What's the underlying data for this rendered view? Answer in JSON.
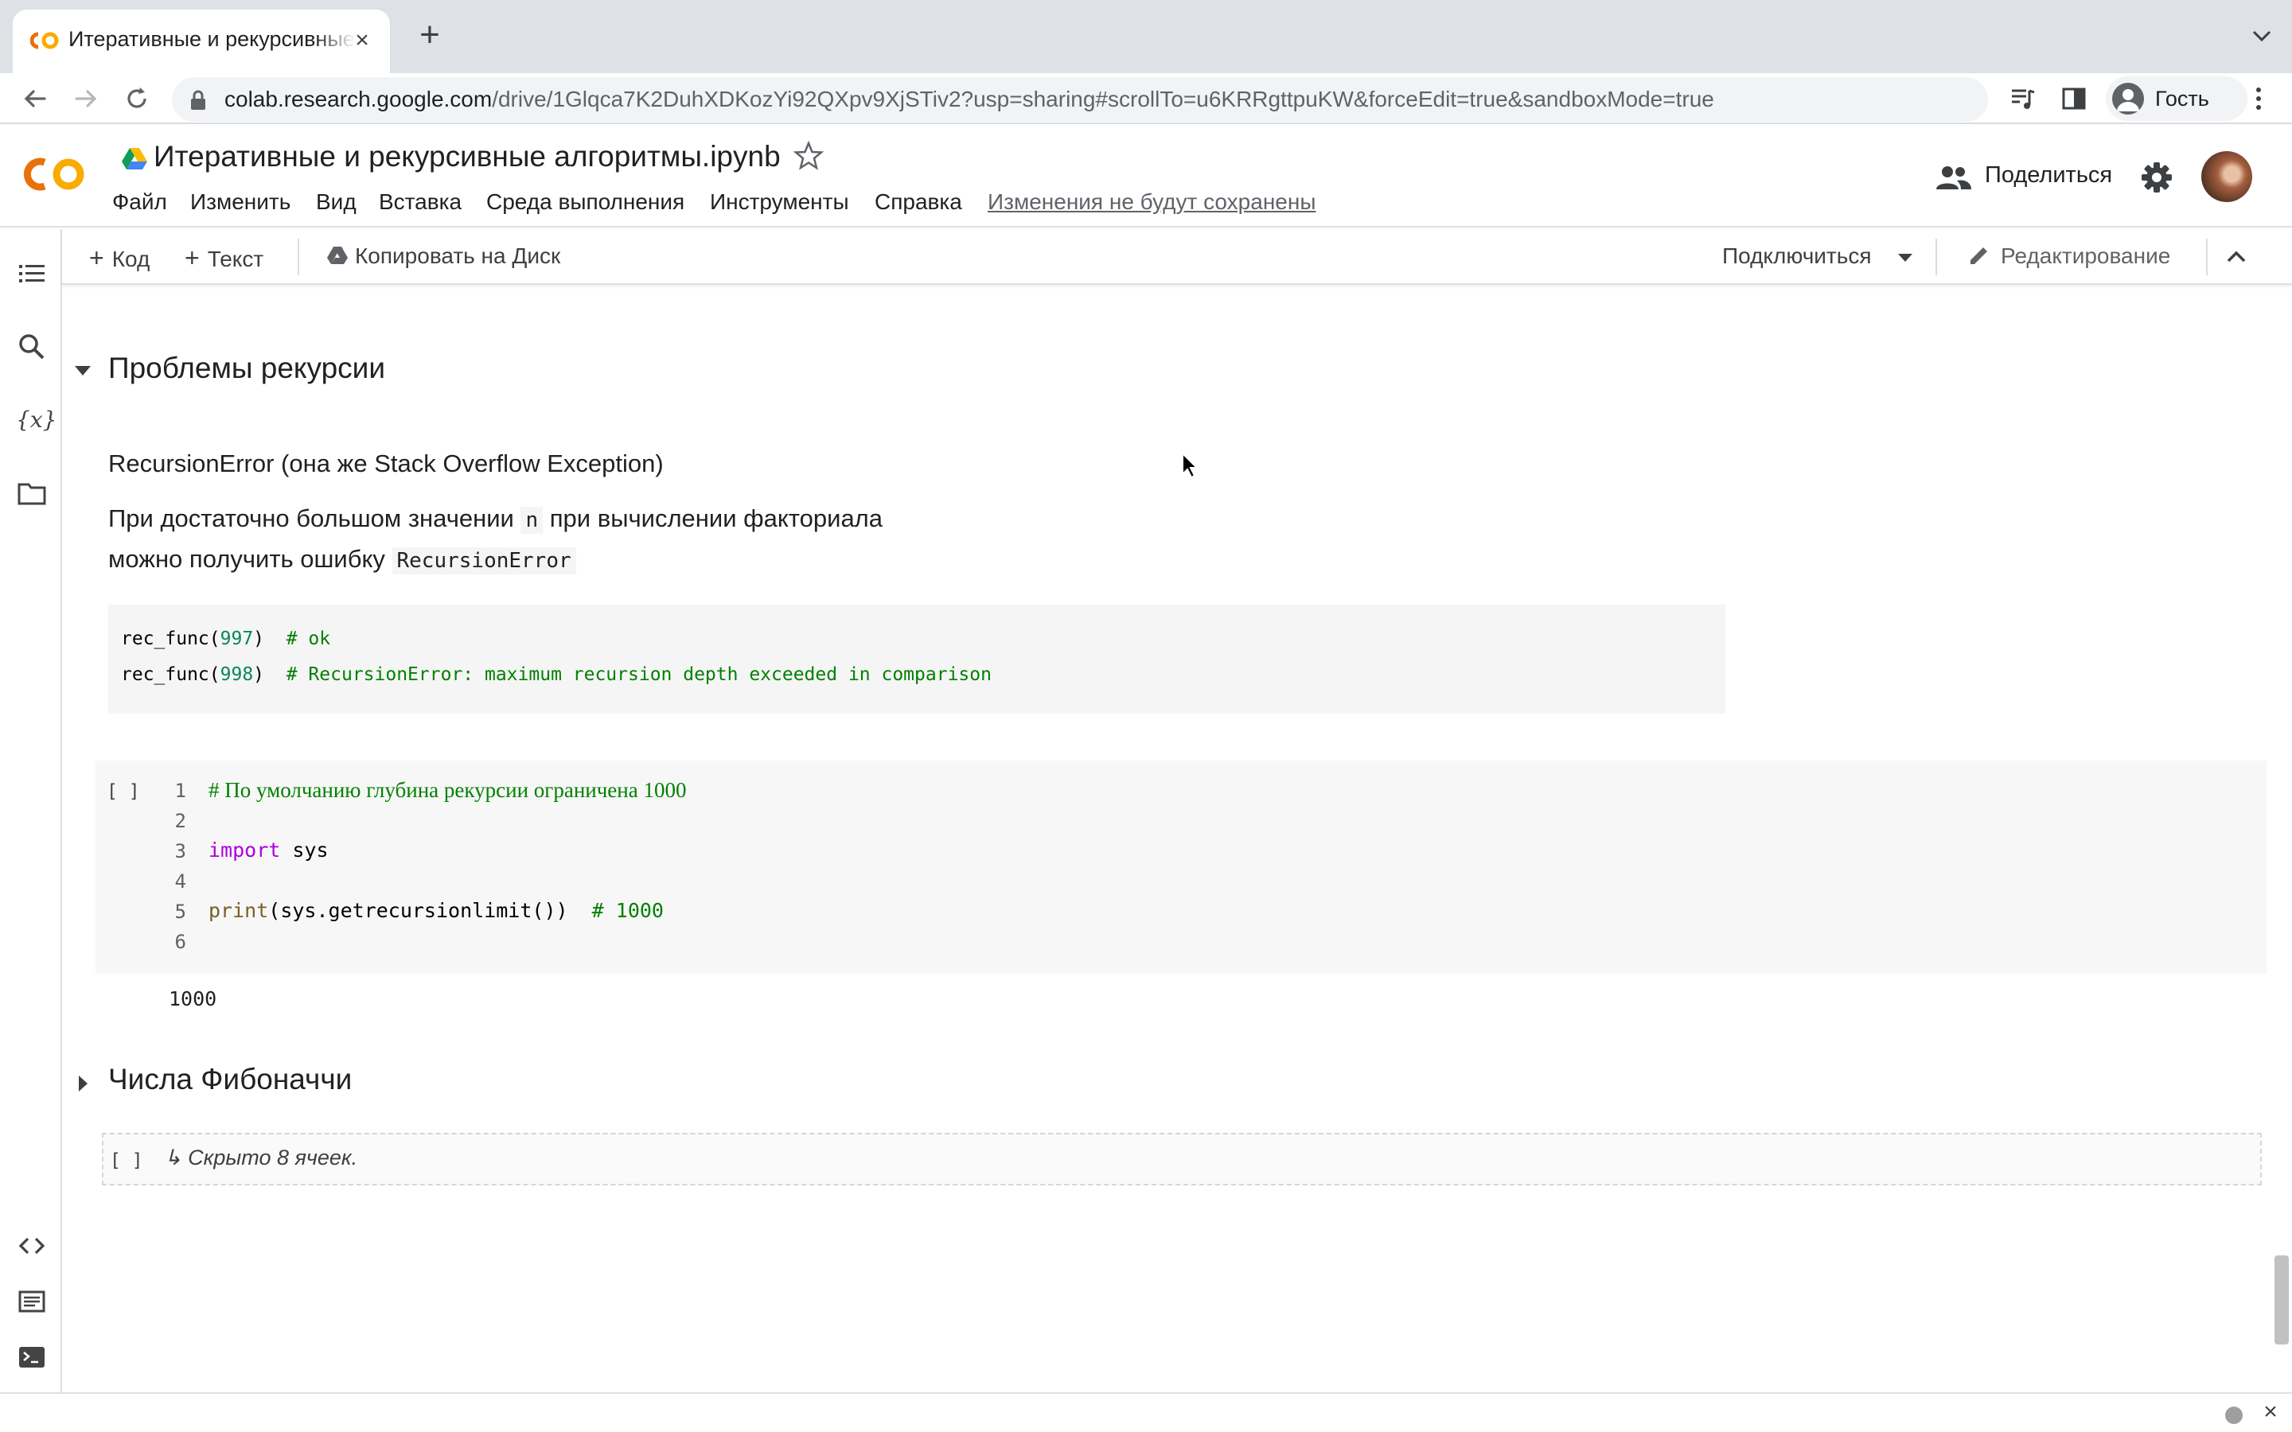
{
  "browser": {
    "tab_title": "Итеративные и рекурсивные алгоритмы.ipynb",
    "url_host": "colab.research.google.com",
    "url_path": "/drive/1Glqca7K2DuhXDKozYi92QXpv9XjSTiv2?usp=sharing#scrollTo=u6KRRgttpuKW&forceEdit=true&sandboxMode=true",
    "profile_label": "Гость",
    "icons": [
      "back-icon",
      "forward-icon",
      "reload-icon",
      "lock-icon",
      "media-icon",
      "side-panel-icon",
      "kebab-menu-icon"
    ]
  },
  "colab": {
    "title": "Итеративные и рекурсивные алгоритмы.ipynb",
    "menu": [
      "Файл",
      "Изменить",
      "Вид",
      "Вставка",
      "Среда выполнения",
      "Инструменты",
      "Справка"
    ],
    "unsaved_notice": "Изменения не будут сохранены",
    "share_label": "Поделиться"
  },
  "cell_toolbar": {
    "add_code": "Код",
    "add_text": "Текст",
    "copy_to_drive": "Копировать на Диск",
    "connect": "Подключиться",
    "editing": "Редактирование"
  },
  "notebook": {
    "section1_title": "Проблемы рекурсии",
    "subtitle": "RecursionError (она же Stack Overflow Exception)",
    "para_line1_a": "При достаточно большом значении",
    "para_line1_code": "n",
    "para_line1_b": "при вычислении факториала",
    "para_line2_a": "можно получить ошибку",
    "para_line2_code": "RecursionError",
    "code_block": {
      "line1_call": "rec_func(",
      "line1_num": "997",
      "line1_close": ")",
      "line1_comment": "# ok",
      "line2_call": "rec_func(",
      "line2_num": "998",
      "line2_close": ")",
      "line2_comment": "# RecursionError: maximum recursion depth exceeded in comparison"
    },
    "code_cell": {
      "bracket": "[ ]",
      "line_numbers": [
        "1",
        "2",
        "3",
        "4",
        "5",
        "6"
      ],
      "line1": "# По умолчанию глубина рекурсии ограничена 1000",
      "line3_kw": "import",
      "line3_rest": " sys",
      "line5_fn": "print",
      "line5_rest": "(sys.getrecursionlimit())",
      "line5_comment": "# 1000",
      "output": "1000"
    },
    "section2_title": "Числа Фибоначчи",
    "hidden_bracket": "[ ]",
    "hidden_label": "↳ Скрыто 8 ячеек."
  },
  "colors": {
    "colab_orange": "#f9ab00",
    "colab_dark_orange": "#e8710a",
    "comment_green": "#008000",
    "keyword_purple": "#af00db",
    "number_green": "#098658"
  }
}
